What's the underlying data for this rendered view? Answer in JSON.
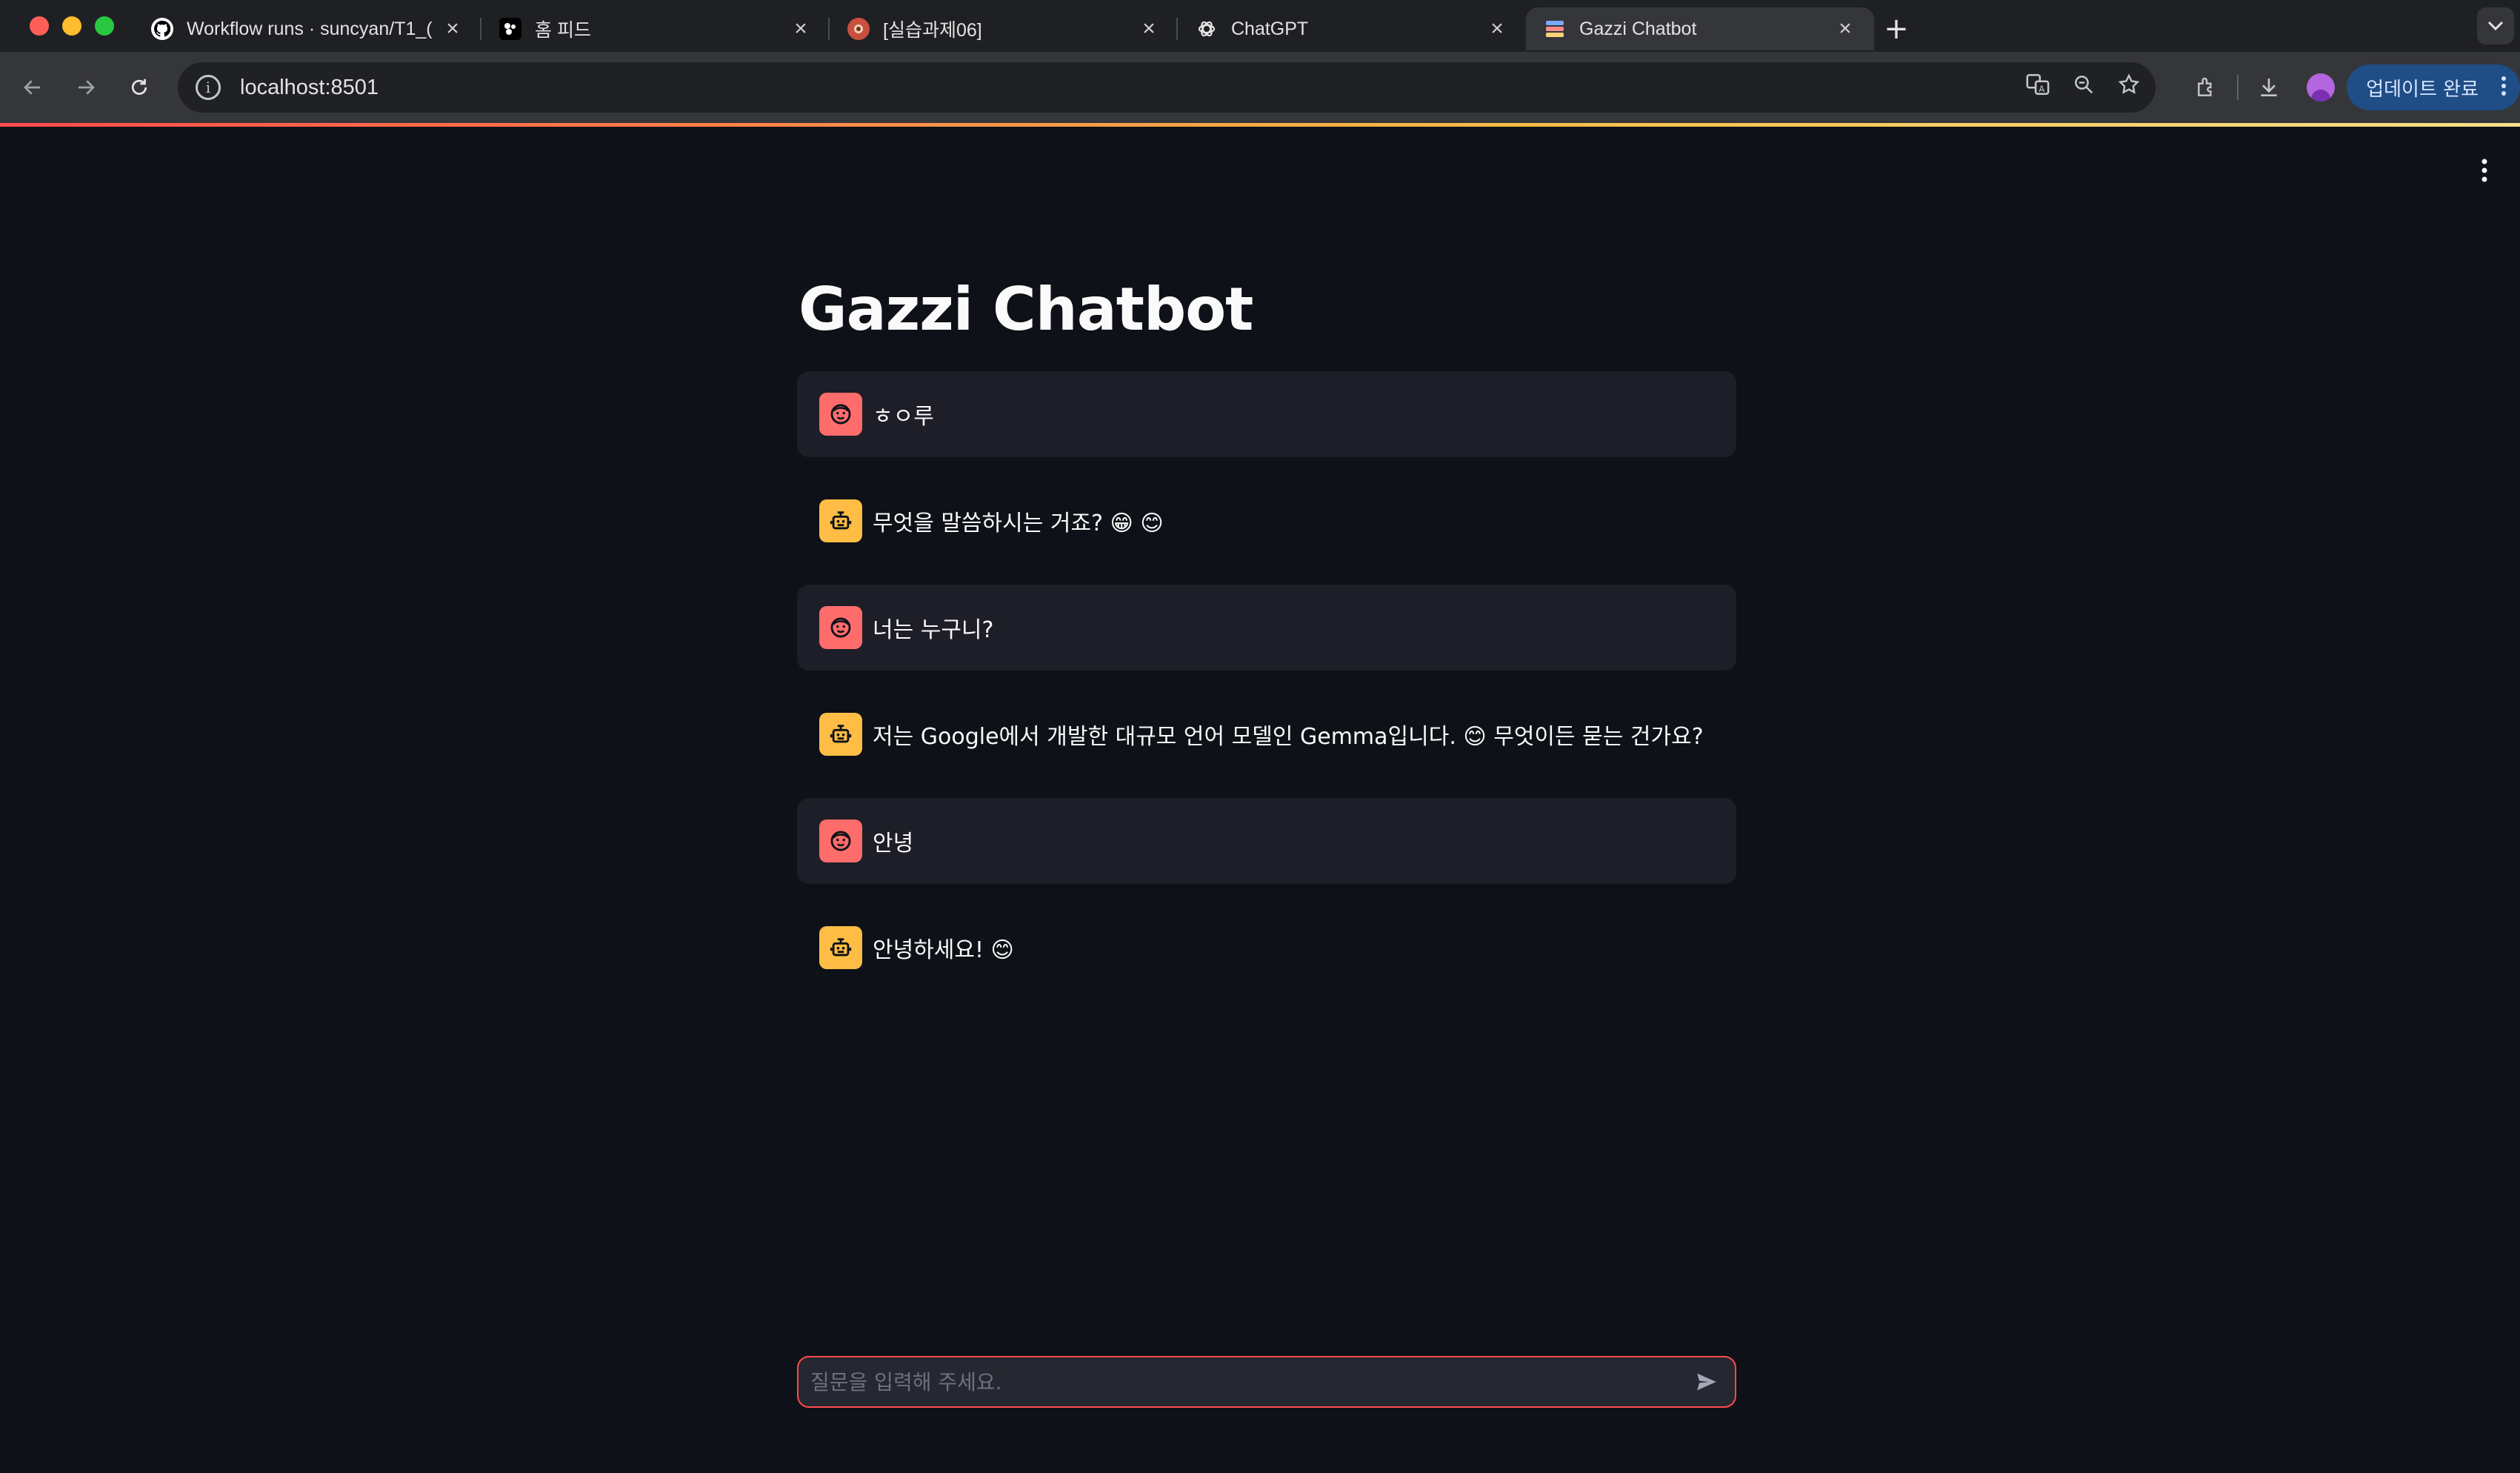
{
  "browser": {
    "tabs": [
      {
        "label": "Workflow runs · suncyan/T1_(",
        "icon": "github-icon"
      },
      {
        "label": "홈 피드",
        "icon": "feed-icon"
      },
      {
        "label": "[실습과제06]",
        "icon": "course-icon"
      },
      {
        "label": "ChatGPT",
        "icon": "openai-icon"
      },
      {
        "label": "Gazzi Chatbot",
        "icon": "streamlit-icon",
        "active": true
      }
    ],
    "address": "localhost:8501",
    "update_button": "업데이트 완료"
  },
  "app": {
    "title": "Gazzi Chatbot",
    "messages": [
      {
        "role": "user",
        "text": "ㅎㅇ루"
      },
      {
        "role": "assistant",
        "text": "무엇을 말씀하시는 거죠? 😁 😊"
      },
      {
        "role": "user",
        "text": "너는 누구니?"
      },
      {
        "role": "assistant",
        "text": "저는 Google에서 개발한 대규모 언어 모델인 Gemma입니다. 😊 무엇이든 묻는 건가요?"
      },
      {
        "role": "user",
        "text": "안녕"
      },
      {
        "role": "assistant",
        "text": "안녕하세요! 😊"
      }
    ],
    "input_placeholder": "질문을 입력해 주세요."
  },
  "colors": {
    "background": "#0e1117",
    "user_avatar": "#ff6c6c",
    "assistant_avatar": "#ffbd45",
    "input_border": "#ff4b4b"
  }
}
